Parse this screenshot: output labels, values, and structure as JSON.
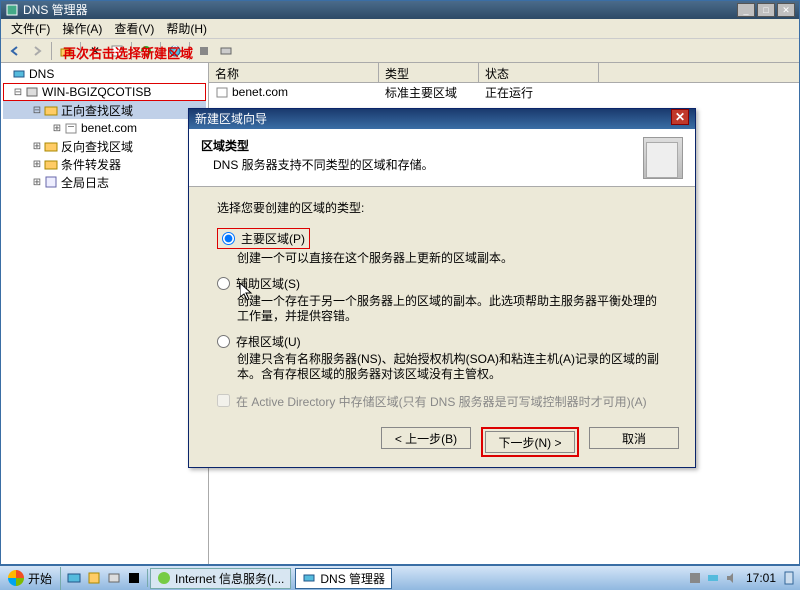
{
  "window": {
    "title": "DNS 管理器"
  },
  "menu": {
    "file": "文件(F)",
    "action": "操作(A)",
    "view": "查看(V)",
    "help": "帮助(H)"
  },
  "annotation": {
    "red_text": "再次右击选择新建区域"
  },
  "tree": {
    "root": "DNS",
    "server": "WIN-BGIZQCOTISB",
    "forward": "正向查找区域",
    "zone": "benet.com",
    "reverse": "反向查找区域",
    "conditional": "条件转发器",
    "global": "全局日志"
  },
  "list": {
    "headers": {
      "name": "名称",
      "type": "类型",
      "status": "状态"
    },
    "row": {
      "name": "benet.com",
      "type": "标准主要区域",
      "status": "正在运行"
    }
  },
  "dialog": {
    "title": "新建区域向导",
    "heading": "区域类型",
    "subheading": "DNS 服务器支持不同类型的区域和存储。",
    "prompt": "选择您要创建的区域的类型:",
    "primary": {
      "label": "主要区域(P)",
      "desc": "创建一个可以直接在这个服务器上更新的区域副本。"
    },
    "secondary": {
      "label": "辅助区域(S)",
      "desc": "创建一个存在于另一个服务器上的区域的副本。此选项帮助主服务器平衡处理的工作量，并提供容错。"
    },
    "stub": {
      "label": "存根区域(U)",
      "desc": "创建只含有名称服务器(NS)、起始授权机构(SOA)和粘连主机(A)记录的区域的副本。含有存根区域的服务器对该区域没有主管权。"
    },
    "adcheckbox": "在 Active Directory 中存储区域(只有 DNS 服务器是可写域控制器时才可用)(A)",
    "back": "< 上一步(B)",
    "next": "下一步(N) >",
    "cancel": "取消"
  },
  "taskbar": {
    "start": "开始",
    "task1": "Internet 信息服务(I...",
    "task2": "DNS 管理器",
    "time": "17:01"
  }
}
